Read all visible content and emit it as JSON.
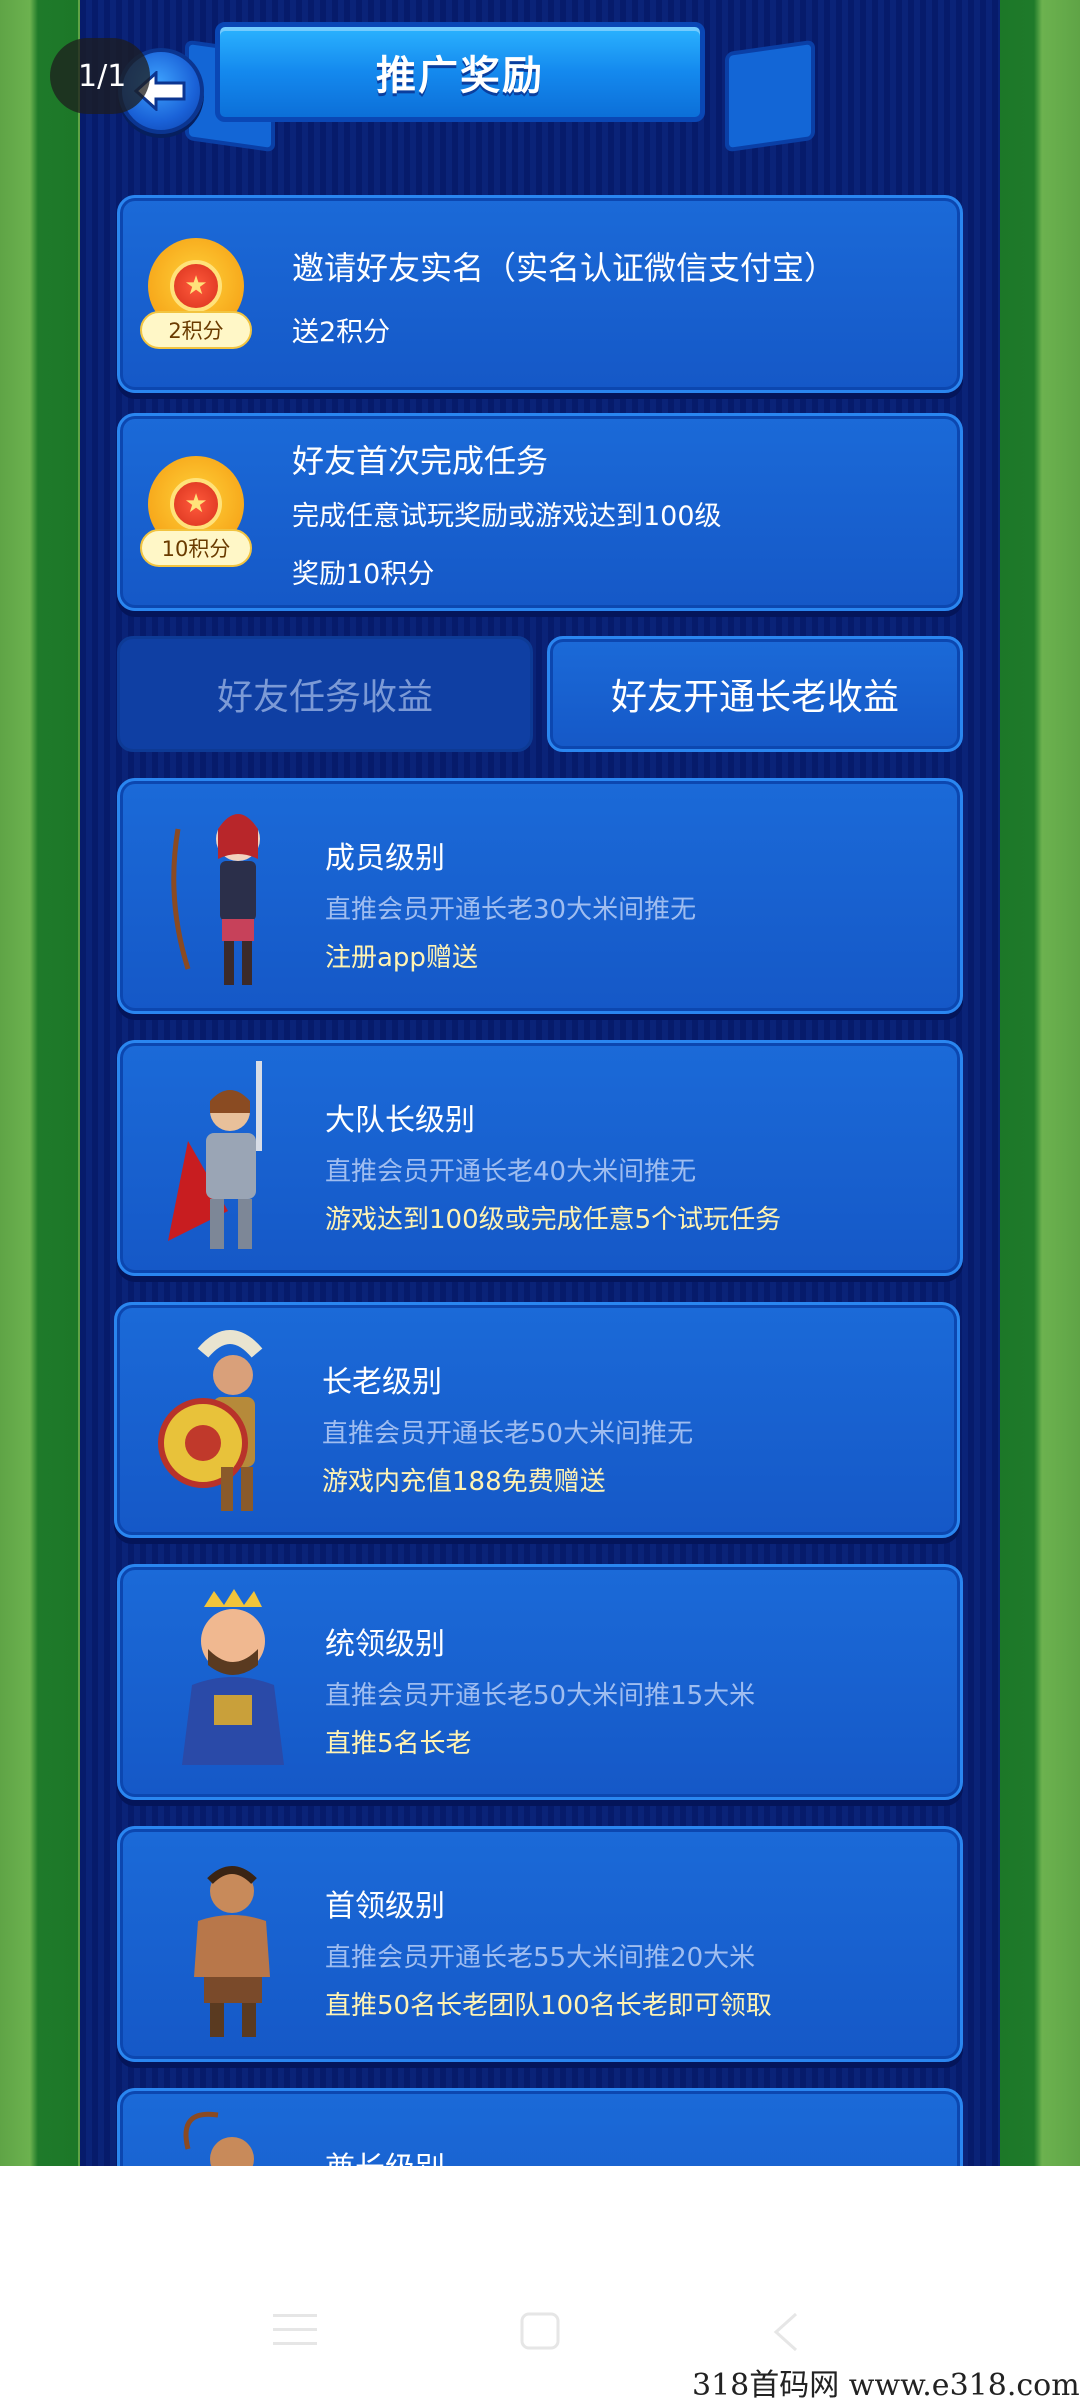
{
  "banner": {
    "title": "推广奖励"
  },
  "page_counter": "1/1",
  "reward_cards": [
    {
      "badge": "2积分",
      "title": "邀请好友实名（实名认证微信支付宝）",
      "lines": [
        "送2积分"
      ]
    },
    {
      "badge": "10积分",
      "title": "好友首次完成任务",
      "lines": [
        "完成任意试玩奖励或游戏达到100级",
        "奖励10积分"
      ]
    }
  ],
  "tabs": [
    {
      "label": "好友任务收益",
      "active": false
    },
    {
      "label": "好友开通长老收益",
      "active": true
    }
  ],
  "levels": [
    {
      "title": "成员级别",
      "desc": "直推会员开通长老30大米间推无",
      "requirement": "注册app赠送",
      "hero_icon": "archer-girl-icon"
    },
    {
      "title": "大队长级别",
      "desc": "直推会员开通长老40大米间推无",
      "requirement": "游戏达到100级或完成任意5个试玩任务",
      "hero_icon": "knight-icon"
    },
    {
      "title": "长老级别",
      "desc": "直推会员开通长老50大米间推无",
      "requirement": "游戏内充值188免费赠送",
      "hero_icon": "spartan-icon"
    },
    {
      "title": "统领级别",
      "desc": "直推会员开通长老50大米间推15大米",
      "requirement": "直推5名长老",
      "hero_icon": "king-icon"
    },
    {
      "title": "首领级别",
      "desc": "直推会员开通长老55大米间推20大米",
      "requirement": "直推50名长老团队100名长老即可领取",
      "hero_icon": "barbarian-icon"
    },
    {
      "title": "酋长级别",
      "desc": "",
      "requirement": "",
      "hero_icon": "chief-icon"
    }
  ],
  "watermark": "318首码网  www.e318.com",
  "colors": {
    "panel": "#1558c7",
    "background": "#061b6b",
    "green": "#1c7828",
    "requirement_text": "#fff3b3"
  }
}
